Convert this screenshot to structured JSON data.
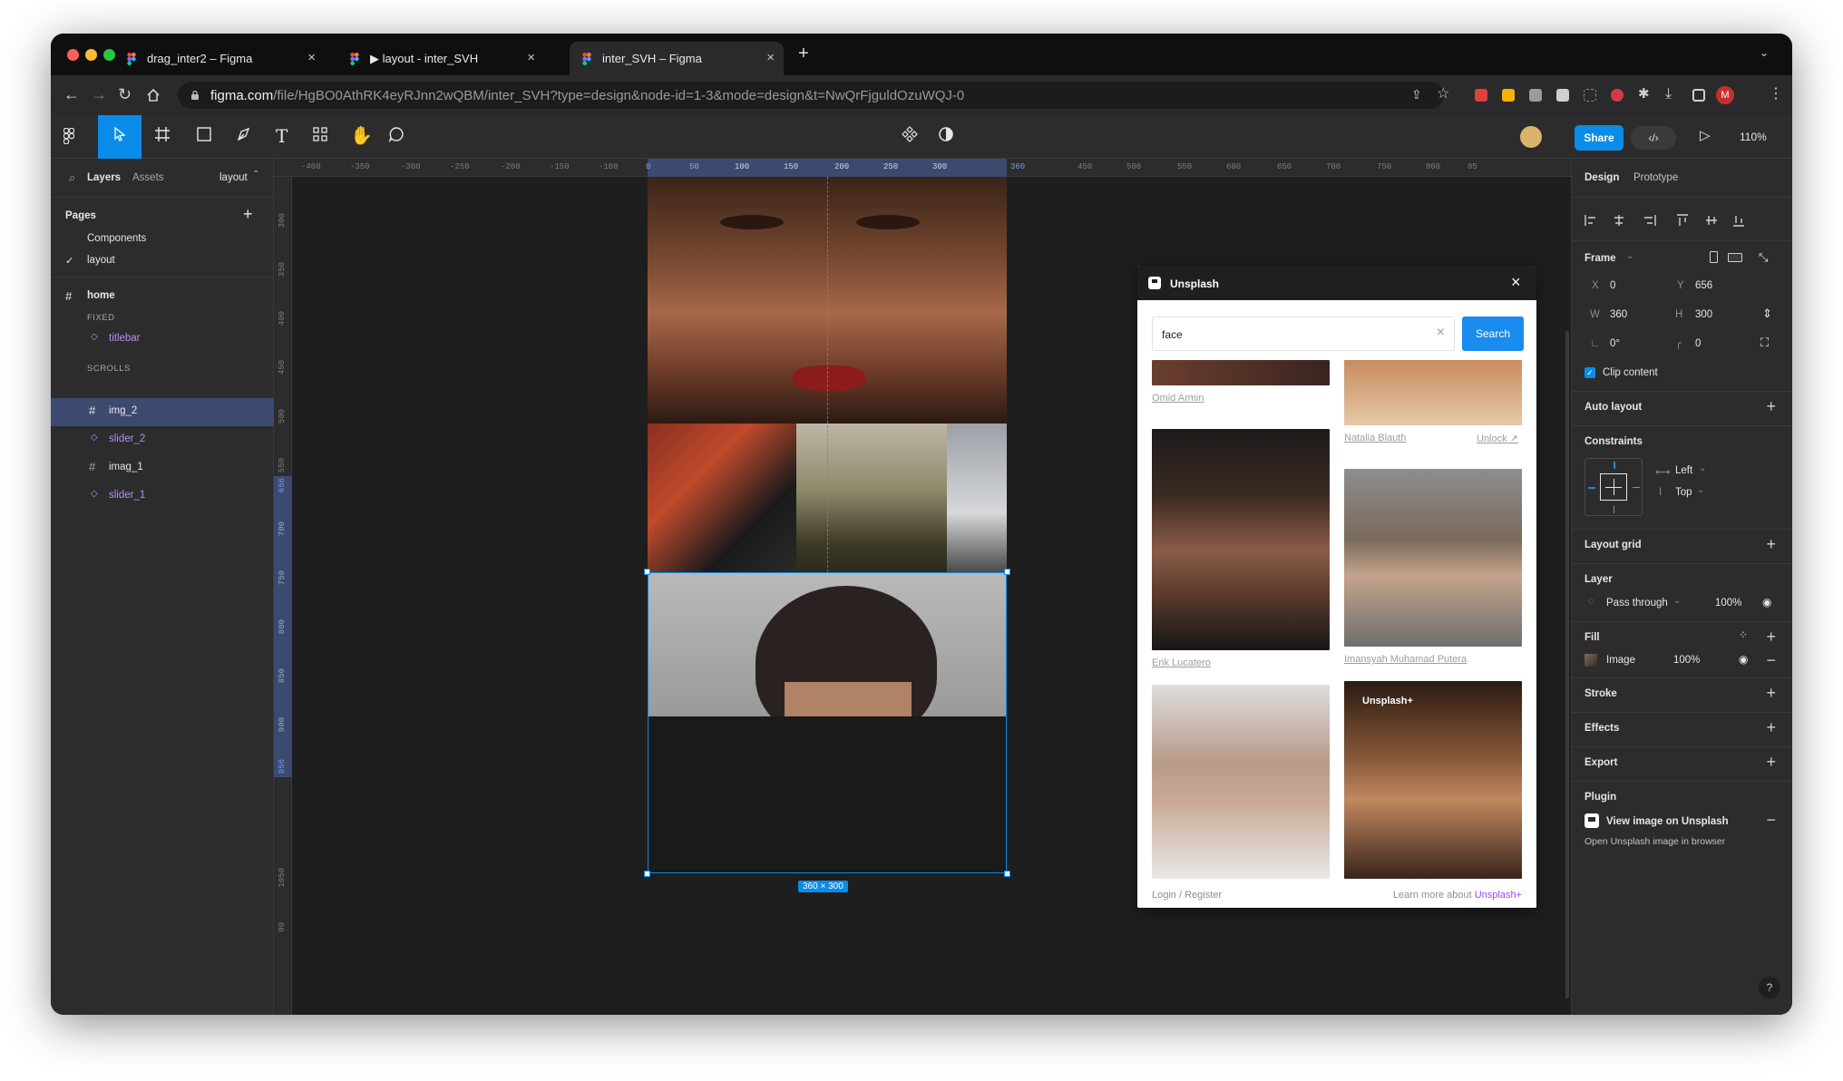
{
  "browser": {
    "tabs": [
      {
        "label": "drag_inter2 – Figma",
        "active": false
      },
      {
        "label": "▶ layout - inter_SVH",
        "active": false
      },
      {
        "label": "inter_SVH – Figma",
        "active": true
      }
    ],
    "url_host": "figma.com",
    "url_path": "/file/HgBO0AthRK4eyRJnn2wQBM/inter_SVH?type=design&node-id=1-3&mode=design&t=NwQrFjguldOzuWQJ-0",
    "profile_initial": "M"
  },
  "toolbar": {
    "share_label": "Share",
    "zoom": "110%"
  },
  "left_panel": {
    "tabs": [
      "Layers",
      "Assets"
    ],
    "page_switch": "layout",
    "pages_title": "Pages",
    "pages": [
      {
        "label": "Components",
        "current": false
      },
      {
        "label": "layout",
        "current": true
      }
    ],
    "layers": {
      "root": "home",
      "sections": [
        "FIXED",
        "SCROLLS"
      ],
      "fixed_items": [
        "titlebar"
      ],
      "scroll_items": [
        "img_2",
        "slider_2",
        "imag_1",
        "slider_1"
      ]
    }
  },
  "rulers": {
    "top": [
      "-400",
      "-350",
      "-300",
      "-250",
      "-200",
      "-150",
      "-100",
      "0",
      "50",
      "100",
      "150",
      "200",
      "250",
      "300",
      "360",
      "450",
      "500",
      "550",
      "600",
      "650",
      "700",
      "750",
      "800",
      "85"
    ],
    "left": [
      "300",
      "350",
      "400",
      "450",
      "500",
      "550",
      "656",
      "700",
      "750",
      "800",
      "850",
      "900",
      "956",
      "1050",
      "00"
    ]
  },
  "canvas": {
    "size_badge": "360 × 300"
  },
  "plugin": {
    "title": "Unsplash",
    "search_value": "face",
    "search_button": "Search",
    "credits": {
      "left_top": "Omid Armin",
      "right_top": "Natalia Blauth",
      "unlock": "Unlock ↗",
      "left_mid": "Erik Lucatero",
      "right_mid": "Imansyah Muhamad Putera"
    },
    "plus_badge": "Unsplash+",
    "footer_left": "Login / Register",
    "footer_learn": "Learn more about ",
    "footer_link": "Unsplash+"
  },
  "right_panel": {
    "tabs": [
      "Design",
      "Prototype"
    ],
    "frame": {
      "label": "Frame",
      "x_label": "X",
      "x": "0",
      "y_label": "Y",
      "y": "656",
      "w_label": "W",
      "w": "360",
      "h_label": "H",
      "h": "300",
      "rotation": "0°",
      "radius": "0",
      "clip": "Clip content"
    },
    "auto_layout": "Auto layout",
    "constraints": {
      "title": "Constraints",
      "horizontal": "Left",
      "vertical": "Top"
    },
    "layout_grid": "Layout grid",
    "layer": {
      "title": "Layer",
      "mode": "Pass through",
      "opacity": "100%"
    },
    "fill": {
      "title": "Fill",
      "type": "Image",
      "opacity": "100%"
    },
    "stroke": "Stroke",
    "effects": "Effects",
    "export": "Export",
    "plugin": {
      "title": "Plugin",
      "action": "View image on Unsplash",
      "description": "Open Unsplash image in browser"
    },
    "help": "?"
  },
  "colors": {
    "accent": "#0c8ce9",
    "layer_purple": "#b690f2",
    "selection": "#3d4a70",
    "unsplash_plus": "#9747ff"
  }
}
